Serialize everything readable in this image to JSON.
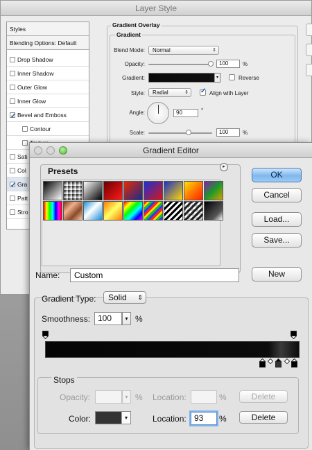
{
  "layer_style": {
    "title": "Layer Style",
    "sidebar": {
      "header": "Styles",
      "blending": "Blending Options: Default",
      "items": [
        {
          "label": "Drop Shadow",
          "checked": false
        },
        {
          "label": "Inner Shadow",
          "checked": false
        },
        {
          "label": "Outer Glow",
          "checked": false
        },
        {
          "label": "Inner Glow",
          "checked": false
        },
        {
          "label": "Bevel and Emboss",
          "checked": true
        },
        {
          "label": "Contour",
          "checked": false
        },
        {
          "label": "Texture",
          "checked": false
        },
        {
          "label": "Sati",
          "checked": false
        },
        {
          "label": "Col",
          "checked": false
        },
        {
          "label": "Gra",
          "checked": true
        },
        {
          "label": "Patt",
          "checked": false
        },
        {
          "label": "Stro",
          "checked": false
        }
      ]
    },
    "panel": {
      "section_title": "Gradient Overlay",
      "group_title": "Gradient",
      "blend_mode_label": "Blend Mode:",
      "blend_mode_value": "Normal",
      "opacity_label": "Opacity:",
      "opacity_value": "100",
      "opacity_unit": "%",
      "gradient_label": "Gradient:",
      "reverse_label": "Reverse",
      "style_label": "Style:",
      "style_value": "Radial",
      "align_label": "Align with Layer",
      "angle_label": "Angle:",
      "angle_value": "90",
      "angle_unit": "°",
      "scale_label": "Scale:",
      "scale_value": "100",
      "scale_unit": "%"
    }
  },
  "gradient_editor": {
    "title": "Gradient Editor",
    "presets_label": "Presets",
    "presets_menu_icon": "▸",
    "buttons": {
      "ok": "OK",
      "cancel": "Cancel",
      "load": "Load...",
      "save": "Save...",
      "new": "New"
    },
    "name_label": "Name:",
    "name_value": "Custom",
    "gradient_type_label": "Gradient Type:",
    "gradient_type_value": "Solid",
    "smoothness_label": "Smoothness:",
    "smoothness_value": "100",
    "smoothness_unit": "%",
    "stops": {
      "title": "Stops",
      "opacity_label": "Opacity:",
      "opacity_unit": "%",
      "opacity_location_label": "Location:",
      "opacity_location_unit": "%",
      "delete_label": "Delete",
      "color_label": "Color:",
      "color_value": "#333333",
      "color_location_label": "Location:",
      "color_location_value": "93",
      "color_location_unit": "%",
      "delete2_label": "Delete"
    },
    "accent_color": "#7fb8ee"
  }
}
